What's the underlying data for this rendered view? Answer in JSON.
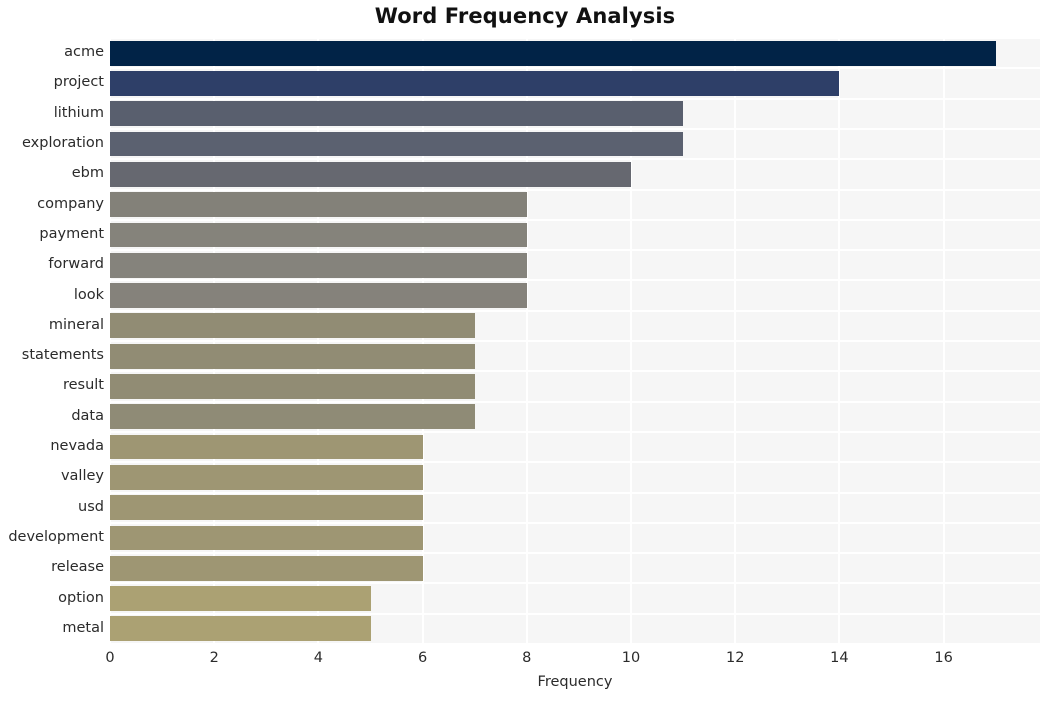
{
  "chart_data": {
    "type": "bar",
    "orientation": "horizontal",
    "title": "Word Frequency Analysis",
    "xlabel": "Frequency",
    "ylabel": "",
    "categories": [
      "acme",
      "project",
      "lithium",
      "exploration",
      "ebm",
      "company",
      "payment",
      "forward",
      "look",
      "mineral",
      "statements",
      "result",
      "data",
      "nevada",
      "valley",
      "usd",
      "development",
      "release",
      "option",
      "metal"
    ],
    "values": [
      17,
      14,
      11,
      11,
      10,
      8,
      8,
      8,
      8,
      7,
      7,
      7,
      7,
      6,
      6,
      6,
      6,
      6,
      5,
      5
    ],
    "bar_colors": [
      "#012347",
      "#2e3f68",
      "#595f6e",
      "#5b6170",
      "#666870",
      "#838179",
      "#85837b",
      "#85837c",
      "#85827b",
      "#918c74",
      "#918c74",
      "#918c74",
      "#8f8b76",
      "#9e9673",
      "#9e9673",
      "#9e9673",
      "#9e9673",
      "#9e9673",
      "#aba173",
      "#aba173"
    ],
    "xlim": [
      0,
      17.85
    ],
    "xticks": [
      0,
      2,
      4,
      6,
      8,
      10,
      12,
      14,
      16
    ],
    "xtick_labels": [
      "0",
      "2",
      "4",
      "6",
      "8",
      "10",
      "12",
      "14",
      "16"
    ],
    "grid": true,
    "grid_axis": "both",
    "grid_color": "#ffffff",
    "plot_background": "#f6f6f6",
    "figure_background": "#ffffff",
    "legend": null,
    "style": "seaborn-darkgrid"
  }
}
